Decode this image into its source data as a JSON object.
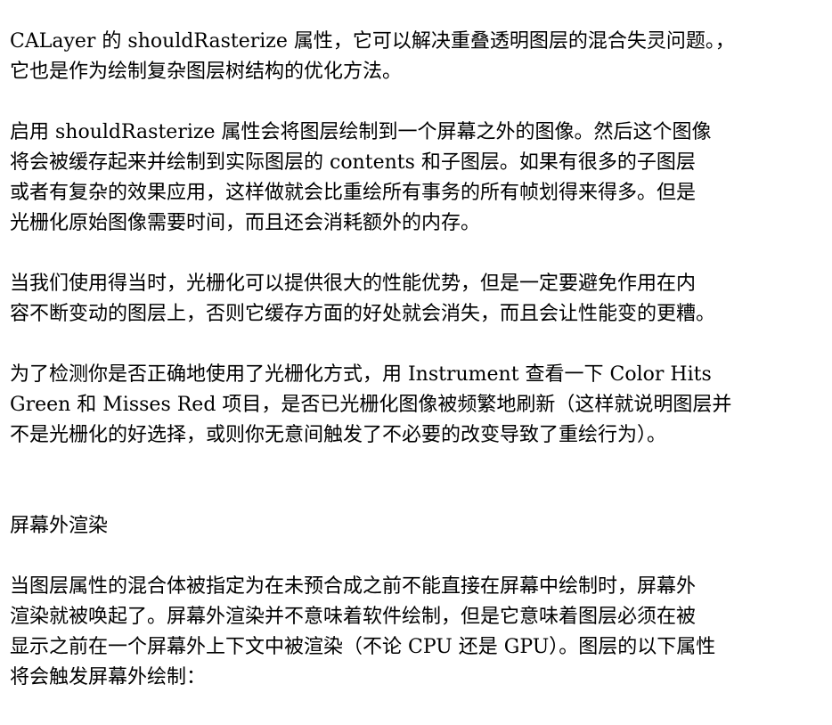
{
  "paragraphs": {
    "p1": [
      "CALayer 的 shouldRasterize 属性，它可以解决重叠透明图层的混合失灵问题。，",
      "它也是作为绘制复杂图层树结构的优化方法。"
    ],
    "p2": [
      "启用 shouldRasterize 属性会将图层绘制到一个屏幕之外的图像。然后这个图像",
      "将会被缓存起来并绘制到实际图层的 contents 和子图层。如果有很多的子图层",
      "或者有复杂的效果应用，这样做就会比重绘所有事务的所有帧划得来得多。但是",
      "光栅化原始图像需要时间，而且还会消耗额外的内存。"
    ],
    "p3": [
      "当我们使用得当时，光栅化可以提供很大的性能优势，但是一定要避免作用在内",
      "容不断变动的图层上，否则它缓存方面的好处就会消失，而且会让性能变的更糟。"
    ],
    "p4": [
      "为了检测你是否正确地使用了光栅化方式，用 Instrument 查看一下 Color Hits",
      "Green 和 Misses Red 项目，是否已光栅化图像被频繁地刷新（这样就说明图层并",
      "不是光栅化的好选择，或则你无意间触发了不必要的改变导致了重绘行为）。"
    ],
    "heading": "屏幕外渲染",
    "p5": [
      "当图层属性的混合体被指定为在未预合成之前不能直接在屏幕中绘制时，屏幕外",
      "渲染就被唤起了。屏幕外渲染并不意味着软件绘制，但是它意味着图层必须在被",
      "显示之前在一个屏幕外上下文中被渲染（不论 CPU 还是 GPU）。图层的以下属性",
      "将会触发屏幕外绘制："
    ]
  }
}
